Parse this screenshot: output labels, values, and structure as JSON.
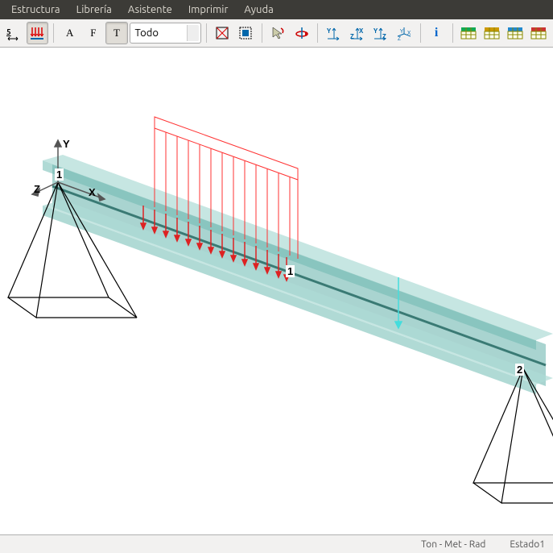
{
  "menu": {
    "estructura": "Estructura",
    "libreria": "Librería",
    "asistente": "Asistente",
    "imprimir": "Imprimir",
    "ayuda": "Ayuda"
  },
  "toolbar": {
    "letter_a": "A",
    "letter_f": "F",
    "letter_t": "T",
    "dropdown_value": "Todo",
    "info_symbol": "i"
  },
  "viewport": {
    "node1": "1",
    "node2": "2",
    "load1": "1",
    "axis_x": "X",
    "axis_y": "Y",
    "axis_z": "Z"
  },
  "status": {
    "units": "Ton - Met - Rad",
    "state": "Estado1"
  }
}
